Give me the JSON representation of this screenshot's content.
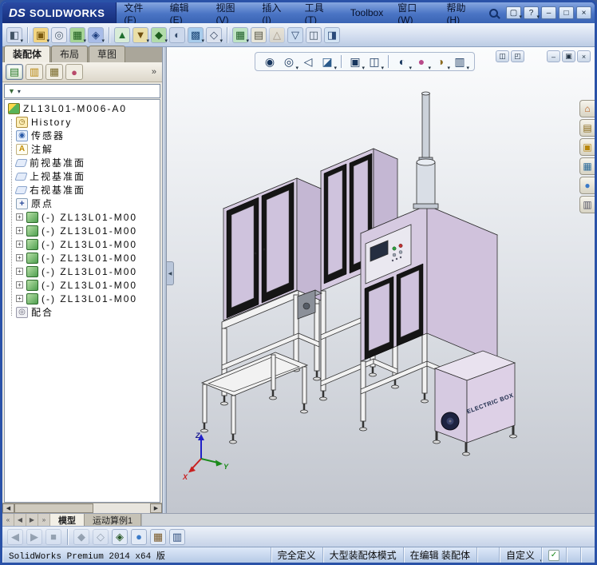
{
  "titlebar": {
    "logo_mark": "DS",
    "logo_text": "SOLIDWORKS",
    "menus": [
      "文件(F)",
      "编辑(E)",
      "视图(V)",
      "插入(I)",
      "工具(T)",
      "Toolbox",
      "窗口(W)",
      "帮助(H)"
    ],
    "controls": [
      {
        "name": "new-document-icon",
        "glyph": "▢",
        "caret": true
      },
      {
        "name": "help-icon",
        "glyph": "?",
        "caret": true
      },
      {
        "name": "minimize-window-icon",
        "glyph": "–"
      },
      {
        "name": "restore-window-icon",
        "glyph": "□"
      },
      {
        "name": "close-window-icon",
        "glyph": "×"
      }
    ]
  },
  "toolbar": {
    "icons": [
      {
        "name": "tools-options-icon",
        "glyph": "◧",
        "bg": "#d8e0f0",
        "fg": "#445566",
        "caret": true
      },
      {
        "sep": true
      },
      {
        "name": "open-document-icon",
        "glyph": "▣",
        "bg": "#f2d582",
        "fg": "#7a5a10",
        "caret": true
      },
      {
        "name": "attach-document-icon",
        "glyph": "◎",
        "bg": "#e4e8f2",
        "fg": "#556677"
      },
      {
        "name": "insert-component-icon",
        "glyph": "▦",
        "bg": "#a6d496",
        "fg": "#1f5f1f",
        "caret": true
      },
      {
        "name": "mate-icon",
        "glyph": "◈",
        "bg": "#a8bce8",
        "fg": "#1f3f7f",
        "caret": true
      },
      {
        "sep": true
      },
      {
        "name": "rebuild-icon",
        "glyph": "▲",
        "bg": "#d8ecd8",
        "fg": "#1f6f2f"
      },
      {
        "name": "smart-fasteners-icon",
        "glyph": "▼",
        "bg": "#eadfa8",
        "fg": "#6f4f10",
        "caret": true
      },
      {
        "name": "move-component-icon",
        "glyph": "◆",
        "bg": "#b2dcaa",
        "fg": "#1f5f1f",
        "caret": true
      },
      {
        "name": "show-hidden-components-icon",
        "glyph": "◐",
        "bg": "#ccd8ec",
        "fg": "#334a6a"
      },
      {
        "name": "assembly-features-icon",
        "glyph": "▩",
        "bg": "#a8ccec",
        "fg": "#1f4a7a",
        "caret": true
      },
      {
        "name": "reference-geometry-icon",
        "glyph": "◇",
        "bg": "#dce2ee",
        "fg": "#3a4a66",
        "caret": true
      },
      {
        "sep": true
      },
      {
        "name": "linear-component-pattern-icon",
        "glyph": "▦",
        "bg": "#bfe4c4",
        "fg": "#21602a",
        "caret": true
      },
      {
        "name": "bill-of-materials-icon",
        "glyph": "▤",
        "bg": "#e8e6da",
        "fg": "#565646"
      },
      {
        "name": "exploded-view-icon",
        "glyph": "△",
        "bg": "#ecd8ae",
        "fg": "#6f4a10",
        "dim": true
      },
      {
        "name": "interference-detection-icon",
        "glyph": "▽",
        "bg": "#ccdcf0",
        "fg": "#2f4a6f"
      },
      {
        "name": "measure-icon",
        "glyph": "◫",
        "bg": "#dfe6f2",
        "fg": "#445566"
      },
      {
        "name": "section-view-icon",
        "glyph": "◨",
        "bg": "#d4e4f4",
        "fg": "#2a4a7a"
      }
    ]
  },
  "panel": {
    "tabs": [
      "装配体",
      "布局",
      "草图"
    ],
    "active_tab_index": 0,
    "manager_icons": [
      {
        "name": "featuremanager-tree-icon",
        "glyph": "▤",
        "fg": "#2a7a2a",
        "cls": "active"
      },
      {
        "name": "propertymanager-icon",
        "glyph": "▥",
        "fg": "#b8860b"
      },
      {
        "name": "configurationmanager-icon",
        "glyph": "▦",
        "fg": "#7a6a2a"
      },
      {
        "name": "displaymanager-icon",
        "glyph": "●",
        "fg": "#b84a6a"
      }
    ],
    "expand_chevron": "»",
    "filter_glyph": "▼",
    "filter_caret": "▾",
    "scroll_left": "◀",
    "scroll_right": "▶",
    "collapse_arrow": "◀"
  },
  "tree": {
    "rows": [
      {
        "label": "ZL13L01-M006-A0",
        "icon": "asm",
        "level": 0,
        "name": "tree-root-assembly"
      },
      {
        "label": "History",
        "icon": "hist",
        "glyph": "◷",
        "level": 1,
        "name": "tree-item-history"
      },
      {
        "label": "传感器",
        "icon": "sens",
        "glyph": "◉",
        "level": 1,
        "name": "tree-item-sensors"
      },
      {
        "label": "注解",
        "icon": "ann",
        "glyph": "A",
        "level": 1,
        "name": "tree-item-annotations"
      },
      {
        "label": "前视基准面",
        "icon": "plane",
        "level": 1,
        "name": "tree-item-front-plane"
      },
      {
        "label": "上视基准面",
        "icon": "plane",
        "level": 1,
        "name": "tree-item-top-plane"
      },
      {
        "label": "右视基准面",
        "icon": "plane",
        "level": 1,
        "name": "tree-item-right-plane"
      },
      {
        "label": "原点",
        "icon": "origin",
        "glyph": "+",
        "level": 1,
        "name": "tree-item-origin"
      },
      {
        "label": "(-) ZL13L01-M00",
        "icon": "comp",
        "level": 1,
        "expander": "+",
        "name": "tree-item-component-1"
      },
      {
        "label": "(-) ZL13L01-M00",
        "icon": "comp",
        "level": 1,
        "expander": "+",
        "name": "tree-item-component-2"
      },
      {
        "label": "(-) ZL13L01-M00",
        "icon": "comp",
        "level": 1,
        "expander": "+",
        "name": "tree-item-component-3"
      },
      {
        "label": "(-) ZL13L01-M00",
        "icon": "comp",
        "level": 1,
        "expander": "+",
        "name": "tree-item-component-4"
      },
      {
        "label": "(-) ZL13L01-M00",
        "icon": "comp",
        "level": 1,
        "expander": "+",
        "name": "tree-item-component-5"
      },
      {
        "label": "(-) ZL13L01-M00",
        "icon": "comp",
        "level": 1,
        "expander": "+",
        "name": "tree-item-component-6"
      },
      {
        "label": "(-) ZL13L01-M00",
        "icon": "comp",
        "level": 1,
        "expander": "+",
        "name": "tree-item-component-7"
      },
      {
        "label": "配合",
        "icon": "mates",
        "glyph": "◎",
        "level": 1,
        "name": "tree-item-mates"
      }
    ]
  },
  "headsup": {
    "icons": [
      {
        "name": "zoom-fit-icon",
        "glyph": "◉",
        "fg": "#17365e"
      },
      {
        "name": "zoom-area-icon",
        "glyph": "◎",
        "fg": "#17365e",
        "caret": true
      },
      {
        "name": "previous-view-icon",
        "glyph": "◁",
        "fg": "#17365e"
      },
      {
        "name": "section-view-icon",
        "glyph": "◪",
        "fg": "#2a5a8a",
        "caret": true
      },
      {
        "sep": true
      },
      {
        "name": "view-orientation-icon",
        "glyph": "▣",
        "fg": "#17365e",
        "caret": true
      },
      {
        "name": "display-style-icon",
        "glyph": "◫",
        "fg": "#17365e",
        "caret": true
      },
      {
        "sep": true
      },
      {
        "name": "hide-show-items-icon",
        "glyph": "◐",
        "fg": "#17365e",
        "caret": true
      },
      {
        "name": "edit-appearance-icon",
        "glyph": "●",
        "fg": "#b84a8a",
        "caret": true
      },
      {
        "name": "apply-scene-icon",
        "glyph": "◑",
        "fg": "#8a6a20",
        "caret": true
      },
      {
        "name": "view-settings-icon",
        "glyph": "▥",
        "fg": "#17365e",
        "caret": true
      }
    ]
  },
  "mdi": {
    "buttons_panes": [
      {
        "name": "split-pane-horizontal-icon",
        "glyph": "◫"
      },
      {
        "name": "split-pane-vertical-icon",
        "glyph": "◰"
      }
    ],
    "buttons_window": [
      {
        "name": "document-minimize-icon",
        "glyph": "–"
      },
      {
        "name": "document-restore-icon",
        "glyph": "▣"
      },
      {
        "name": "document-close-icon",
        "glyph": "×"
      }
    ]
  },
  "taskpane": {
    "icons": [
      {
        "name": "solidworks-resources-icon",
        "glyph": "⌂",
        "fg": "#b85a1a"
      },
      {
        "name": "design-library-icon",
        "glyph": "▤",
        "fg": "#8a6a1a"
      },
      {
        "name": "file-explorer-icon",
        "glyph": "▣",
        "fg": "#b8860b"
      },
      {
        "name": "view-palette-icon",
        "glyph": "▦",
        "fg": "#2a6a9a"
      },
      {
        "name": "appearances-scenes-icon",
        "glyph": "●",
        "fg": "#3a7ac8"
      },
      {
        "name": "custom-properties-icon",
        "glyph": "▥",
        "fg": "#555566"
      }
    ]
  },
  "doc_tabs": {
    "nav": [
      {
        "name": "scroll-first-tab-icon",
        "glyph": "«"
      },
      {
        "name": "scroll-prev-tab-icon",
        "glyph": "◀"
      },
      {
        "name": "scroll-next-tab-icon",
        "glyph": "▶"
      },
      {
        "name": "scroll-last-tab-icon",
        "glyph": "»"
      }
    ],
    "tabs": [
      "模型",
      "运动算例1"
    ],
    "active_tab_index": 0
  },
  "bottom_toolbar": {
    "icons": [
      {
        "name": "playback-prev-icon",
        "glyph": "◀",
        "dim": true,
        "fg": "#445566"
      },
      {
        "name": "playback-play-icon",
        "glyph": "▶",
        "dim": true,
        "fg": "#445566"
      },
      {
        "name": "playback-stop-icon",
        "glyph": "■",
        "dim": true,
        "fg": "#445566"
      },
      {
        "sep": true
      },
      {
        "name": "mass-properties-icon",
        "glyph": "◆",
        "dim": true,
        "fg": "#445566"
      },
      {
        "name": "measure-tool-icon",
        "glyph": "◇",
        "dim": true,
        "fg": "#445566"
      },
      {
        "name": "check-entity-icon",
        "glyph": "◈",
        "fg": "#2a5a2a"
      },
      {
        "name": "edit-appearance-icon",
        "glyph": "●",
        "fg": "#3a7ac8"
      },
      {
        "name": "apply-texture-icon",
        "glyph": "▦",
        "fg": "#7a5a2a"
      },
      {
        "name": "view-palette-icon",
        "glyph": "▥",
        "fg": "#2a4a7a"
      }
    ]
  },
  "statusbar": {
    "product": "SolidWorks Premium 2014 x64 版",
    "define_status": "完全定义",
    "assembly_mode": "大型装配体模式",
    "editing": "在编辑 装配体",
    "custom": "自定义",
    "check_glyph": "✓"
  },
  "model": {
    "electric_box_label": "ELECTRIC BOX",
    "triad": {
      "x": "X",
      "y": "Y",
      "z": "Z"
    }
  },
  "colors": {
    "model_lavender": "#d6cae1",
    "model_lavender_dark": "#c4b7d3",
    "door_frame_black": "#151515",
    "titlebar_blue": "#4a74c4"
  }
}
